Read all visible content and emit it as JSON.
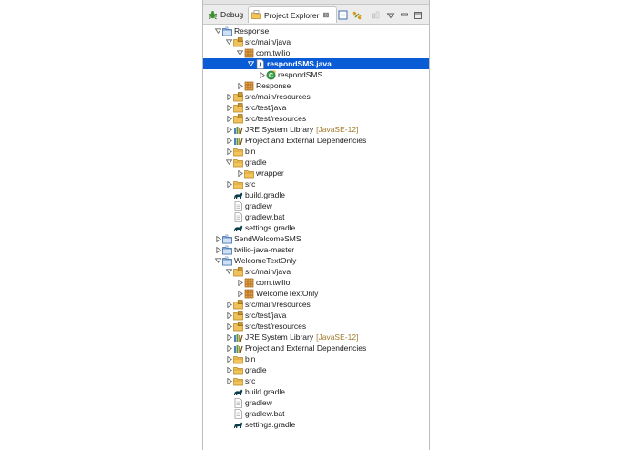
{
  "tabs": {
    "debug": {
      "label": "Debug",
      "icon": "bug-icon"
    },
    "project_explorer": {
      "label": "Project Explorer",
      "icon": "project-explorer-icon",
      "close": "⊠"
    }
  },
  "toolbar": [
    "collapse-all-icon",
    "link-with-editor-icon",
    "filters-icon",
    "view-menu-icon",
    "minimize-icon",
    "maximize-icon"
  ],
  "colors": {
    "selection": "#0a5bd6",
    "library_suffix": "#a37a2b",
    "gradle": "#0b3d4a"
  },
  "tree": [
    {
      "label": "Response",
      "icon": "project",
      "level": 0,
      "arrow": "expanded"
    },
    {
      "label": "src/main/java",
      "icon": "source-folder",
      "level": 1,
      "arrow": "expanded"
    },
    {
      "label": "com.twilio",
      "icon": "package",
      "level": 2,
      "arrow": "expanded"
    },
    {
      "label": "respondSMS.java",
      "icon": "java-file",
      "level": 3,
      "arrow": "expanded",
      "selected": true
    },
    {
      "label": "respondSMS",
      "icon": "class",
      "level": 4,
      "arrow": "collapsed"
    },
    {
      "label": "Response",
      "icon": "package",
      "level": 2,
      "arrow": "collapsed"
    },
    {
      "label": "src/main/resources",
      "icon": "source-folder",
      "level": 1,
      "arrow": "collapsed"
    },
    {
      "label": "src/test/java",
      "icon": "source-folder",
      "level": 1,
      "arrow": "collapsed"
    },
    {
      "label": "src/test/resources",
      "icon": "source-folder",
      "level": 1,
      "arrow": "collapsed"
    },
    {
      "label": "JRE System Library",
      "suffix": "[JavaSE-12]",
      "icon": "library",
      "level": 1,
      "arrow": "collapsed"
    },
    {
      "label": "Project and External Dependencies",
      "icon": "library",
      "level": 1,
      "arrow": "collapsed"
    },
    {
      "label": "bin",
      "icon": "folder",
      "level": 1,
      "arrow": "collapsed"
    },
    {
      "label": "gradle",
      "icon": "folder",
      "level": 1,
      "arrow": "expanded"
    },
    {
      "label": "wrapper",
      "icon": "folder",
      "level": 2,
      "arrow": "collapsed"
    },
    {
      "label": "src",
      "icon": "folder",
      "level": 1,
      "arrow": "collapsed"
    },
    {
      "label": "build.gradle",
      "icon": "gradle",
      "level": 1,
      "arrow": "none"
    },
    {
      "label": "gradlew",
      "icon": "file",
      "level": 1,
      "arrow": "none"
    },
    {
      "label": "gradlew.bat",
      "icon": "file",
      "level": 1,
      "arrow": "none"
    },
    {
      "label": "settings.gradle",
      "icon": "gradle",
      "level": 1,
      "arrow": "none"
    },
    {
      "label": "SendWelcomeSMS",
      "icon": "project",
      "level": 0,
      "arrow": "collapsed"
    },
    {
      "label": "twilio-java-master",
      "icon": "project",
      "level": 0,
      "arrow": "collapsed"
    },
    {
      "label": "WelcomeTextOnly",
      "icon": "project",
      "level": 0,
      "arrow": "expanded"
    },
    {
      "label": "src/main/java",
      "icon": "source-folder",
      "level": 1,
      "arrow": "expanded"
    },
    {
      "label": "com.twilio",
      "icon": "package",
      "level": 2,
      "arrow": "collapsed"
    },
    {
      "label": "WelcomeTextOnly",
      "icon": "package",
      "level": 2,
      "arrow": "collapsed"
    },
    {
      "label": "src/main/resources",
      "icon": "source-folder",
      "level": 1,
      "arrow": "collapsed"
    },
    {
      "label": "src/test/java",
      "icon": "source-folder",
      "level": 1,
      "arrow": "collapsed"
    },
    {
      "label": "src/test/resources",
      "icon": "source-folder",
      "level": 1,
      "arrow": "collapsed"
    },
    {
      "label": "JRE System Library",
      "suffix": "[JavaSE-12]",
      "icon": "library",
      "level": 1,
      "arrow": "collapsed"
    },
    {
      "label": "Project and External Dependencies",
      "icon": "library",
      "level": 1,
      "arrow": "collapsed"
    },
    {
      "label": "bin",
      "icon": "folder",
      "level": 1,
      "arrow": "collapsed"
    },
    {
      "label": "gradle",
      "icon": "folder",
      "level": 1,
      "arrow": "collapsed"
    },
    {
      "label": "src",
      "icon": "folder",
      "level": 1,
      "arrow": "collapsed"
    },
    {
      "label": "build.gradle",
      "icon": "gradle",
      "level": 1,
      "arrow": "none"
    },
    {
      "label": "gradlew",
      "icon": "file",
      "level": 1,
      "arrow": "none"
    },
    {
      "label": "gradlew.bat",
      "icon": "file",
      "level": 1,
      "arrow": "none"
    },
    {
      "label": "settings.gradle",
      "icon": "gradle",
      "level": 1,
      "arrow": "none"
    }
  ]
}
